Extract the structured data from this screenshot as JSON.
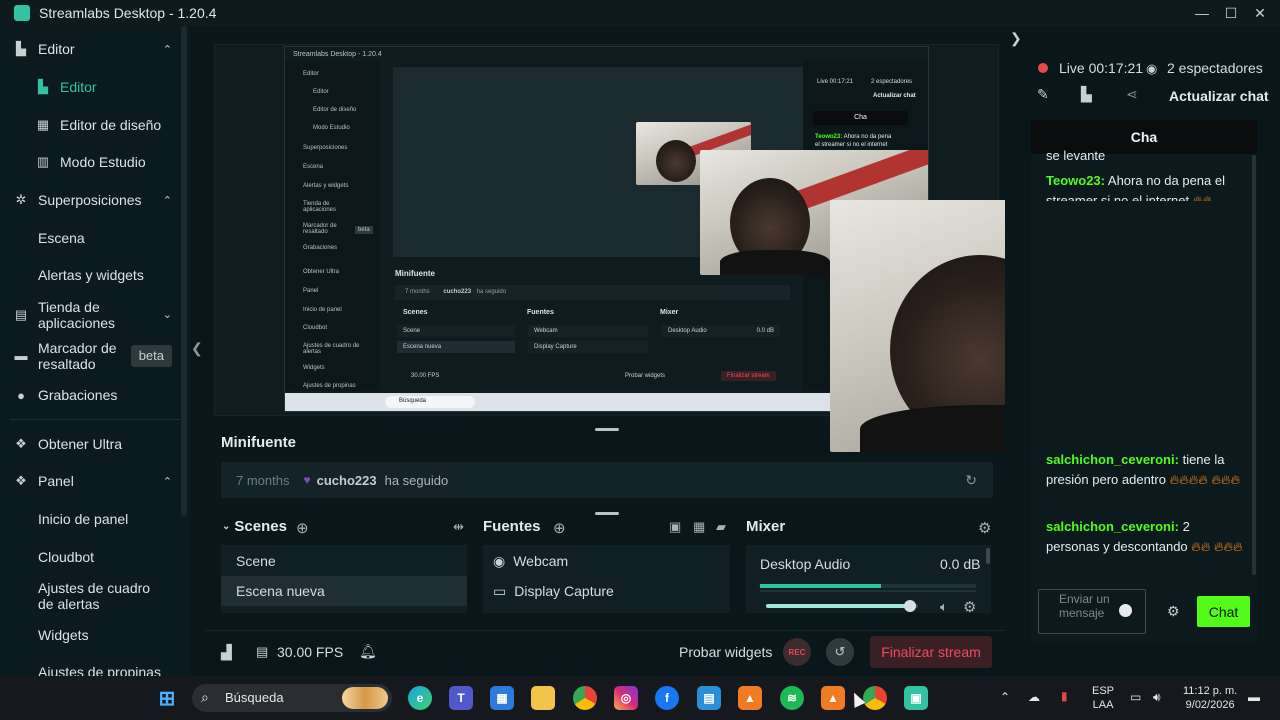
{
  "window": {
    "title": "Streamlabs Desktop - 1.20.4",
    "controls": [
      "—",
      "☐",
      "✕"
    ]
  },
  "sidebar": {
    "items": [
      {
        "label": "Editor",
        "icon": "editor-icon"
      },
      {
        "label": "Editor",
        "icon": "editor-icon"
      },
      {
        "label": "Editor de diseño",
        "icon": "layout-icon"
      },
      {
        "label": "Modo Estudio",
        "icon": "studio-icon"
      },
      {
        "label": "Superposiciones",
        "icon": "overlays-icon"
      },
      {
        "label": "Escena"
      },
      {
        "label": "Alertas y widgets"
      },
      {
        "label": "Tienda de aplicaciones",
        "icon": "store-icon"
      },
      {
        "label": "Marcador de resaltado",
        "icon": "highlighter-icon",
        "badge": "beta"
      },
      {
        "label": "Grabaciones",
        "icon": "recordings-icon"
      },
      {
        "label": "Obtener Ultra",
        "icon": "ultra-icon"
      },
      {
        "label": "Panel",
        "icon": "panel-icon"
      },
      {
        "label": "Inicio de panel"
      },
      {
        "label": "Cloudbot"
      },
      {
        "label": "Ajustes de cuadro de alertas"
      },
      {
        "label": "Widgets"
      },
      {
        "label": "Ajustes de propinas"
      }
    ]
  },
  "nested_preview": {
    "title": "Streamlabs Desktop - 1.20.4",
    "sidebar": [
      "Editor",
      "Editor",
      "Editor de diseño",
      "Modo Estudio",
      "Superposiciones",
      "Escena",
      "Alertas y widgets",
      "Tienda de aplicaciones",
      "Marcador de resaltado",
      "Grabaciones",
      "Obtener Ultra",
      "Panel",
      "Inicio de panel",
      "Cloudbot",
      "Ajustes de cuadro de alertas",
      "Widgets",
      "Ajustes de propinas"
    ],
    "beta": "beta",
    "minifuente": "Minifuente",
    "mf_age": "7 months",
    "mf_user": "cucho223",
    "mf_action": "ha seguido",
    "scenes": "Scenes",
    "fuentes": "Fuentes",
    "mixer": "Mixer",
    "scene1": "Scene",
    "scene2": "Escena nueva",
    "src1": "Webcam",
    "src2": "Display Capture",
    "audio": "Desktop Audio",
    "db": "0.0 dB",
    "fps": "30.00 FPS",
    "probar": "Probar widgets",
    "finalizar": "Finalizar stream",
    "search": "Búsqueda",
    "live": "Live 00:17:21",
    "viewers": "2 espectadores",
    "actualizar": "Actualizar chat",
    "chat": "Cha",
    "teowo_user": "Teowo23:",
    "teowo_text": "Ahora no da pena el streamer si no el internet"
  },
  "minifuente": {
    "title": "Minifuente",
    "age": "7 months",
    "user": "cucho223",
    "action": "ha seguido"
  },
  "scenes": {
    "title": "Scenes",
    "items": [
      "Scene",
      "Escena nueva"
    ]
  },
  "fuentes": {
    "title": "Fuentes",
    "items": [
      {
        "label": "Webcam",
        "icon": "webcam-icon"
      },
      {
        "label": "Display Capture",
        "icon": "monitor-icon"
      }
    ]
  },
  "mixer": {
    "title": "Mixer",
    "source": "Desktop Audio",
    "level": "0.0 dB",
    "volume_fraction": 0.95,
    "meter_fraction": 0.56
  },
  "footer": {
    "fps": "30.00 FPS",
    "probar": "Probar widgets",
    "rec": "REC",
    "finalizar": "Finalizar stream"
  },
  "chat": {
    "live": "Live 00:17:21",
    "viewers": "2 espectadores",
    "actualizar": "Actualizar chat",
    "header": "Cha",
    "cut_text": "se levante",
    "messages": [
      {
        "user": "Teowo23:",
        "text": "Ahora no da pena el streamer si no el internet",
        "user_color": "#53fc18",
        "fires": 2
      },
      {
        "user": "salchichon_ceveroni:",
        "text": "tiene la presión pero adentro",
        "user_color": "#53fc18",
        "fires": 7
      },
      {
        "user": "salchichon_ceveroni:",
        "text": "2 personas y descontando",
        "user_color": "#53fc18",
        "fires": 5
      }
    ],
    "placeholder": "Enviar un mensaje",
    "send": "Chat"
  },
  "taskbar": {
    "search": "Búsqueda",
    "lang_top": "ESP",
    "lang_bottom": "LAA",
    "time": "11:12 p. m.",
    "date": "9/02/2026",
    "apps": [
      "windows-icon",
      "edge-icon",
      "teams-icon",
      "store-icon",
      "folder-icon",
      "chrome-icon",
      "instagram-icon",
      "facebook-icon",
      "notepad-icon",
      "fl-studio-icon",
      "spotify-icon",
      "fl-studio-icon",
      "chrome-icon",
      "streamlabs-icon"
    ]
  },
  "colors": {
    "accent": "#31c3a2",
    "kick_green": "#53fc18",
    "danger": "#ef4d5d"
  }
}
